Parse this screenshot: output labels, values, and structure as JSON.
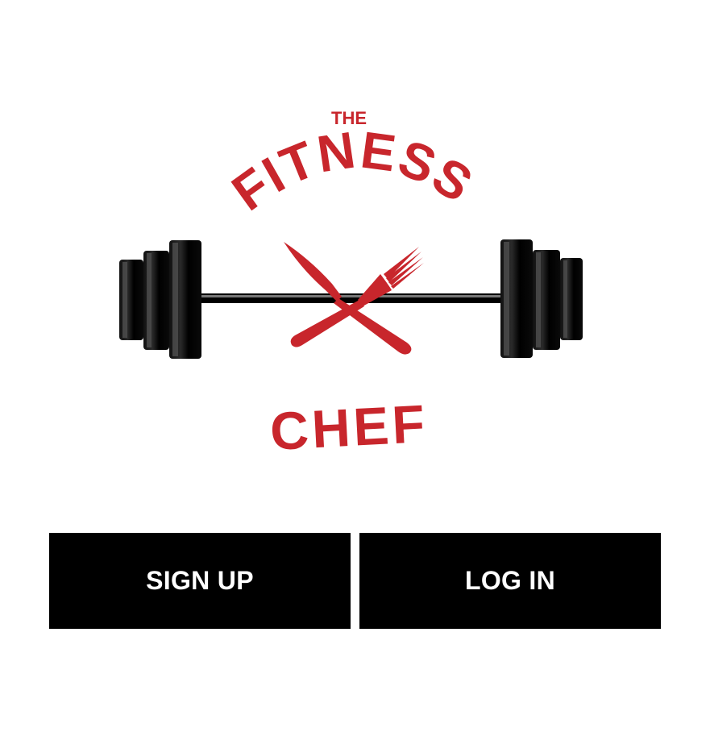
{
  "logo": {
    "text_top": "THE",
    "text_arc": "FITNESS",
    "text_bottom": "CHEF",
    "brand_color": "#C8262C",
    "icons": [
      "barbell-icon",
      "knife-icon",
      "fork-icon"
    ]
  },
  "actions": {
    "signup_label": "SIGN UP",
    "login_label": "LOG IN",
    "button_bg": "#000000",
    "button_fg": "#FFFFFF"
  }
}
